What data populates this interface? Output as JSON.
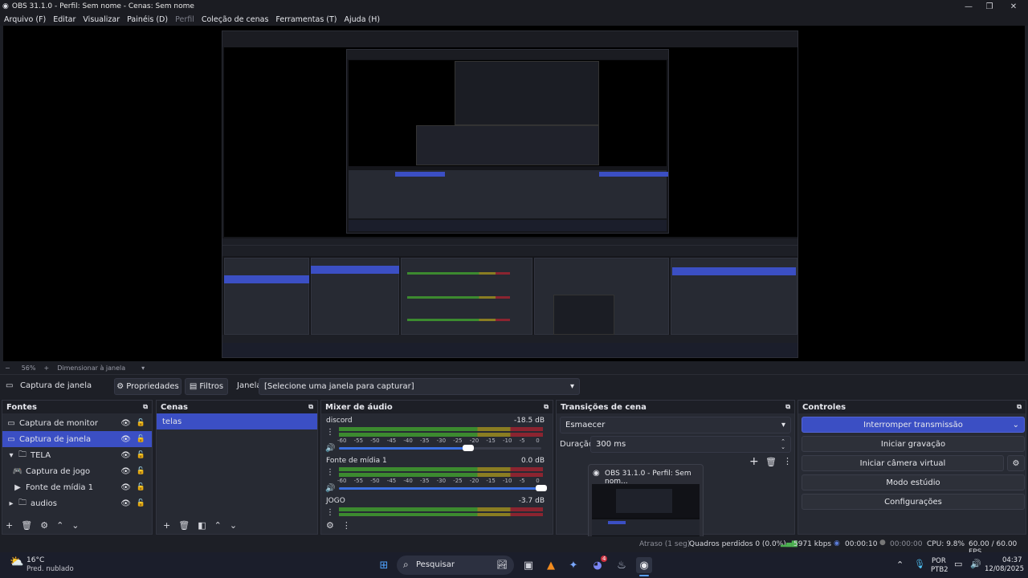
{
  "window": {
    "title": "OBS 31.1.0 - Perfil: Sem nome - Cenas: Sem nome"
  },
  "menu": [
    "Arquivo (F)",
    "Editar",
    "Visualizar",
    "Painéis (D)",
    "Perfil",
    "Coleção de cenas",
    "Ferramentas (T)",
    "Ajuda (H)"
  ],
  "zoom": {
    "minus": "−",
    "value": "56%",
    "plus": "+",
    "fit_label": "Dimensionar à janela"
  },
  "source_toolbar": {
    "selected_source": "Captura de janela",
    "properties": "Propriedades",
    "filters": "Filtros",
    "window_label": "Janela",
    "window_value": "[Selecione uma janela para capturar]"
  },
  "sources": {
    "title": "Fontes",
    "items": [
      {
        "label": "Captura de monitor",
        "icon": "monitor-icon"
      },
      {
        "label": "Captura de janela",
        "icon": "window-icon"
      },
      {
        "label": "TELA",
        "icon": "folder-icon"
      },
      {
        "label": "Captura de jogo",
        "icon": "gamepad-icon"
      },
      {
        "label": "Fonte de mídia 1",
        "icon": "play-icon"
      },
      {
        "label": "audios",
        "icon": "folder-icon"
      }
    ]
  },
  "scenes": {
    "title": "Cenas",
    "items": [
      "telas"
    ]
  },
  "mixer": {
    "title": "Mixer de áudio",
    "ticks": [
      "-60",
      "-55",
      "-50",
      "-45",
      "-40",
      "-35",
      "-30",
      "-25",
      "-20",
      "-15",
      "-10",
      "-5",
      "0"
    ],
    "channels": [
      {
        "name": "discord",
        "db": "-18.5 dB",
        "volume": 0.64
      },
      {
        "name": "Fonte de mídia 1",
        "db": "0.0 dB",
        "volume": 1.0
      },
      {
        "name": "JOGO",
        "db": "-3.7 dB",
        "volume": 0.9
      }
    ]
  },
  "transitions": {
    "title": "Transições de cena",
    "selected": "Esmaecer",
    "duration_label": "Duração",
    "duration_value": "300 ms",
    "preview_title": "OBS 31.1.0 - Perfil: Sem nom..."
  },
  "controls": {
    "title": "Controles",
    "stop_stream": "Interromper transmissão",
    "start_recording": "Iniciar gravação",
    "start_virtual_camera": "Iniciar câmera virtual",
    "studio_mode": "Modo estúdio",
    "settings": "Configurações"
  },
  "status": {
    "delay_text": "Atraso (1 seg)",
    "dropped_frames": "Quadros perdidos 0 (0.0%)",
    "bitrate": "5971 kbps",
    "stream_time": "00:00:10",
    "rec_time": "00:00:00",
    "cpu": "CPU: 9.8%",
    "fps": "60.00 / 60.00 FPS"
  },
  "taskbar": {
    "weather_temp": "16°C",
    "weather_desc": "Pred. nublado",
    "search": "Pesquisar",
    "discord_badge": "4",
    "lang": "POR",
    "layout": "PTB2",
    "time": "04:37",
    "date": "12/08/2025"
  },
  "colors": {
    "accent": "#3b4fc4",
    "meter_green": "#3c8a2f",
    "meter_yellow": "#8a7d22",
    "meter_red": "#8b2430"
  }
}
